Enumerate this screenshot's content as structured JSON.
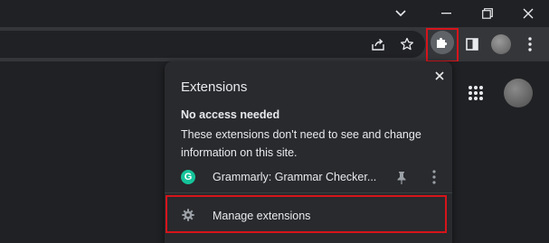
{
  "window_controls": {
    "tab_search_icon": "chevron-down-icon",
    "minimize_icon": "minimize-icon",
    "restore_icon": "restore-icon",
    "close_icon": "close-icon"
  },
  "toolbar": {
    "share_icon": "share-icon",
    "bookmark_icon": "star-icon",
    "extensions_icon": "puzzle-icon",
    "side_panel_icon": "side-panel-icon",
    "menu_icon": "kebab-menu-icon"
  },
  "extensions_popup": {
    "title": "Extensions",
    "section_heading": "No access needed",
    "section_description": "These extensions don't need to see and change information on this site.",
    "extensions": [
      {
        "name": "Grammarly: Grammar Checker...",
        "icon_letter": "G",
        "icon_color": "#15c39a"
      }
    ],
    "manage_label": "Manage extensions"
  },
  "colors": {
    "background": "#202124",
    "toolbar": "#35363a",
    "popup": "#292a2d",
    "highlight": "#d6141b",
    "text": "#e8eaed"
  }
}
